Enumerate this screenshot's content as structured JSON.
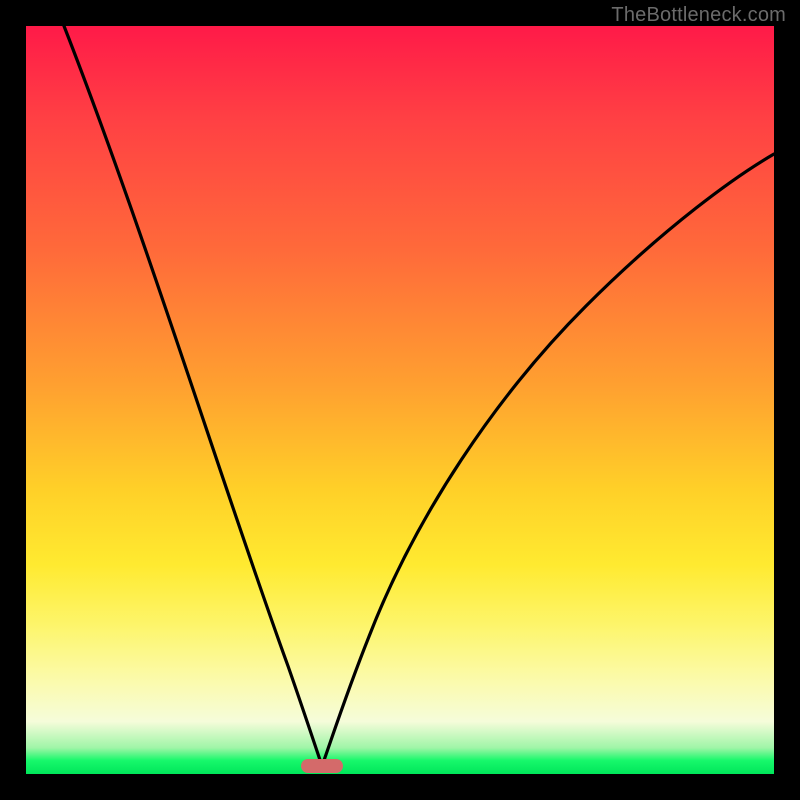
{
  "watermark": "TheBottleneck.com",
  "colors": {
    "frame": "#000000",
    "gradient_top": "#ff1a48",
    "gradient_mid": "#ffd028",
    "gradient_bottom": "#00e65a",
    "curve": "#000000",
    "marker": "#d46a6a"
  },
  "chart_data": {
    "type": "line",
    "title": "",
    "xlabel": "",
    "ylabel": "",
    "xlim": [
      0,
      100
    ],
    "ylim": [
      0,
      100
    ],
    "x": [
      0,
      5,
      10,
      15,
      20,
      25,
      30,
      33,
      36,
      38,
      39.5,
      41,
      44,
      48,
      55,
      62,
      70,
      78,
      86,
      94,
      100
    ],
    "series": [
      {
        "name": "bottleneck-curve",
        "values": [
          100,
          88,
          75,
          62,
          49,
          36,
          22,
          12,
          5,
          1.5,
          0,
          1.5,
          6,
          14,
          28,
          40,
          50,
          58,
          65,
          70,
          74
        ]
      }
    ],
    "minimum_x": 39.5,
    "marker": {
      "x_center": 39.5,
      "width_pct": 5.6
    }
  }
}
